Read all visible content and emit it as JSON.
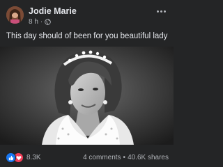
{
  "post": {
    "author": "Jodie Marie",
    "time": "8 h",
    "separator": "·",
    "caption": "This day should of been for you beautiful lady",
    "reactions_count": "8.3K",
    "comments": "4 comments",
    "stats_separator": "•",
    "shares": "40.6K shares"
  },
  "icons": {
    "privacy": "globe-icon",
    "more": "more-options-icon",
    "reaction_1": "like-icon",
    "reaction_2": "love-icon"
  },
  "colors": {
    "background": "#242526",
    "text_primary": "#e4e6eb",
    "text_secondary": "#b0b3b8",
    "like_blue": "#1877f2",
    "love_red": "#f33e58"
  }
}
